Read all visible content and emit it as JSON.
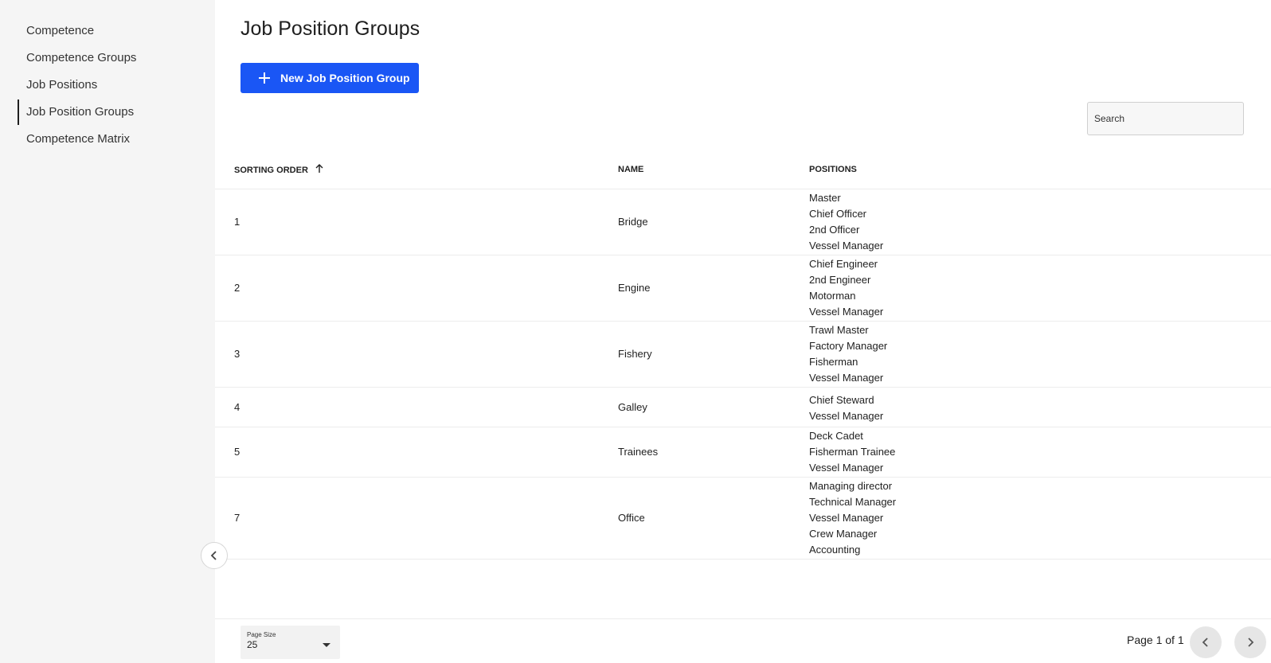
{
  "sidebar": {
    "items": [
      {
        "label": "Competence",
        "active": false
      },
      {
        "label": "Competence Groups",
        "active": false
      },
      {
        "label": "Job Positions",
        "active": false
      },
      {
        "label": "Job Position Groups",
        "active": true
      },
      {
        "label": "Competence Matrix",
        "active": false
      }
    ],
    "collapse_icon": "chevron-left-icon"
  },
  "header": {
    "title": "Job Position Groups",
    "new_button_label": "New Job Position Group",
    "new_button_icon": "plus-icon"
  },
  "search": {
    "placeholder": "Search"
  },
  "table": {
    "columns": {
      "sorting_order": "SORTING ORDER",
      "name": "NAME",
      "positions": "POSITIONS"
    },
    "sort_icon": "arrow-up-icon",
    "rows": [
      {
        "order": "1",
        "name": "Bridge",
        "positions": [
          "Master",
          "Chief Officer",
          "2nd Officer",
          "Vessel Manager"
        ]
      },
      {
        "order": "2",
        "name": "Engine",
        "positions": [
          "Chief Engineer",
          "2nd Engineer",
          "Motorman",
          "Vessel Manager"
        ]
      },
      {
        "order": "3",
        "name": "Fishery",
        "positions": [
          "Trawl Master",
          "Factory Manager",
          "Fisherman",
          "Vessel Manager"
        ]
      },
      {
        "order": "4",
        "name": "Galley",
        "positions": [
          "Chief Steward",
          "Vessel Manager"
        ]
      },
      {
        "order": "5",
        "name": "Trainees",
        "positions": [
          "Deck Cadet",
          "Fisherman Trainee",
          "Vessel Manager"
        ]
      },
      {
        "order": "7",
        "name": "Office",
        "positions": [
          "Managing director",
          "Technical Manager",
          "Vessel Manager",
          "Crew Manager",
          "Accounting"
        ]
      }
    ]
  },
  "footer": {
    "page_size_label": "Page Size",
    "page_size_value": "25",
    "page_info": "Page 1 of 1",
    "prev_icon": "chevron-left-icon",
    "next_icon": "chevron-right-icon"
  },
  "colors": {
    "accent": "#1a56f5",
    "sidebar_bg": "#f5f5f5"
  }
}
